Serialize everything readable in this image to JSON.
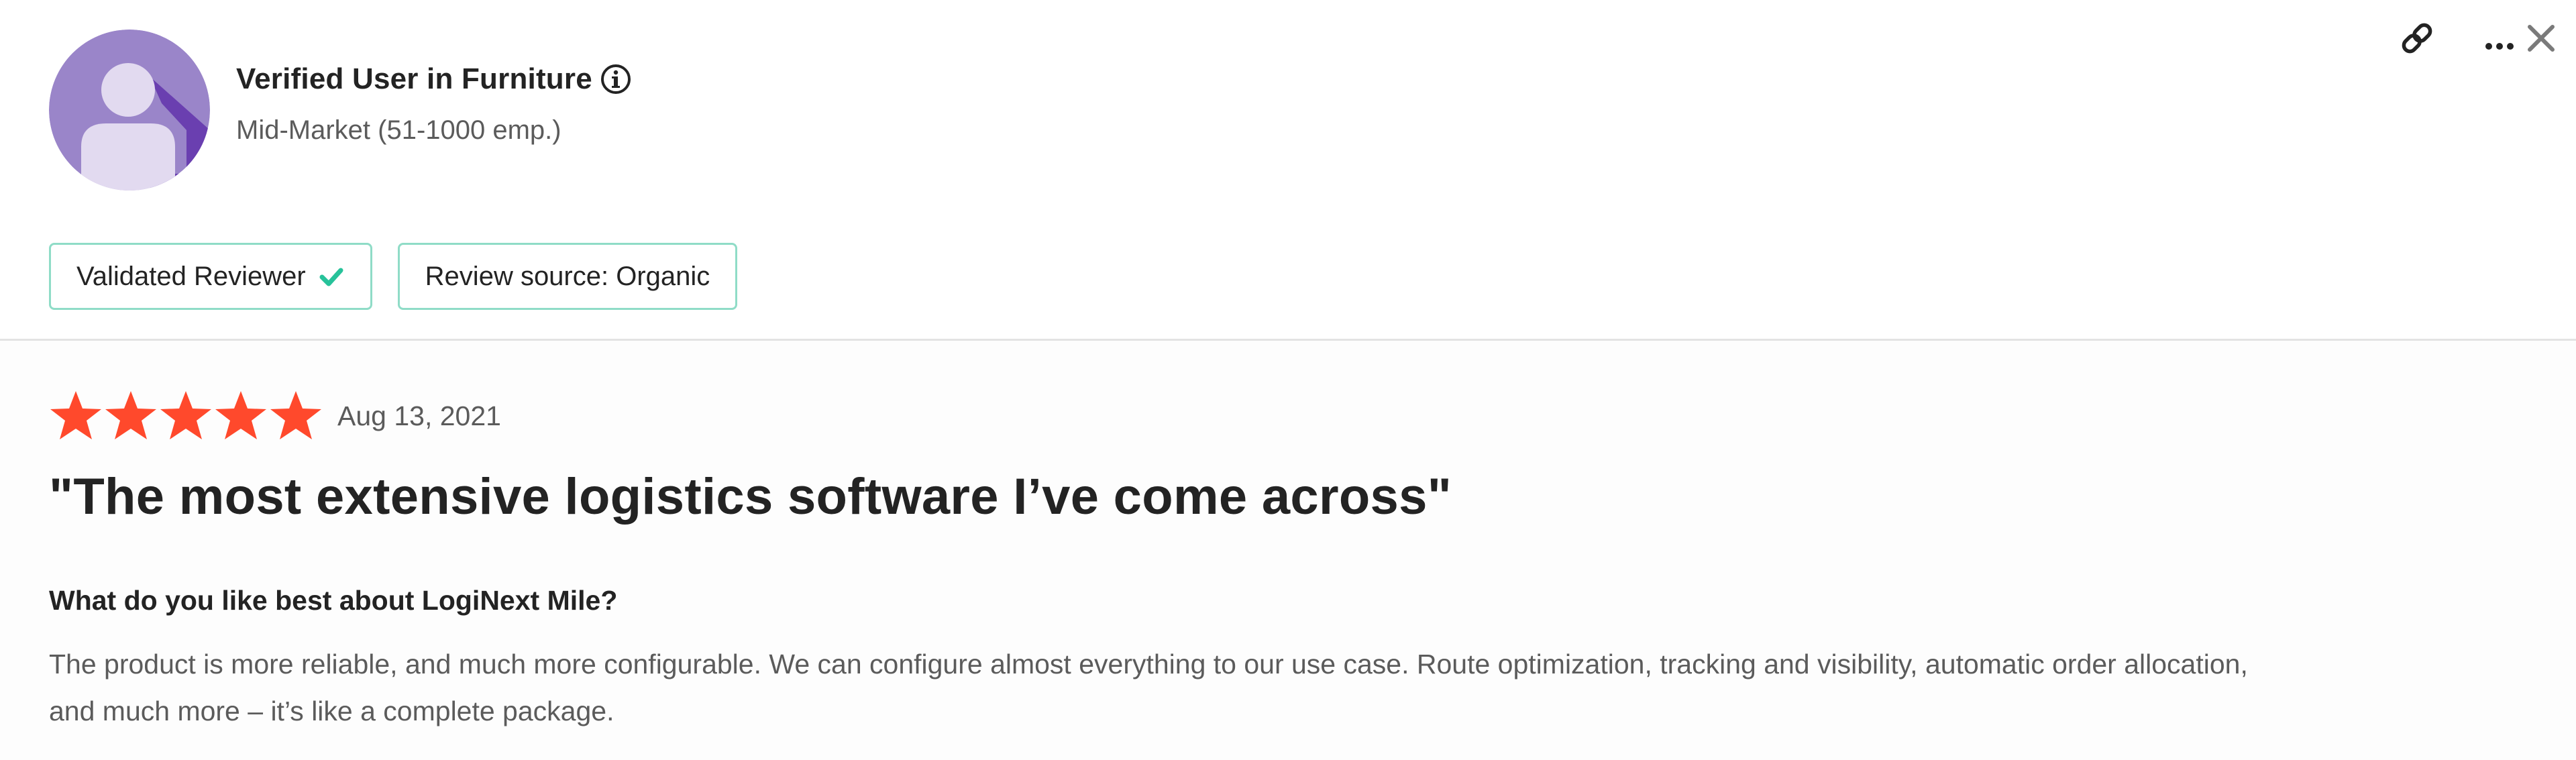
{
  "reviewer": {
    "name": "Verified User in Furniture",
    "segment": "Mid-Market (51-1000 emp.)"
  },
  "badges": [
    {
      "label": "Validated Reviewer"
    },
    {
      "label": "Review source: Organic"
    }
  ],
  "actions": {
    "more_label": "..."
  },
  "review": {
    "rating": 5,
    "rating_max": 5,
    "date": "Aug 13, 2021",
    "title": "\"The most extensive logistics software I’ve come across\"",
    "question": "What do you like best about LogiNext Mile?",
    "answer_lines": [
      "The product is more reliable, and much more configurable. We can configure almost everything to our use case. Route optimization, tracking and visibility, automatic order allocation,",
      "and much more – it’s like a complete package."
    ]
  },
  "colors": {
    "star": "#ff492c",
    "badge_border": "#8fdcc7",
    "check": "#27c29a",
    "avatar_bg": "#9a85c9",
    "avatar_shadow": "#6a3fb0",
    "avatar_figure": "#e2daf0"
  },
  "icons": {
    "info": "info-circle-icon",
    "link": "link-icon",
    "more": "ellipsis-icon",
    "close": "close-icon",
    "check": "check-icon",
    "star": "star-icon",
    "avatar": "user-avatar-icon"
  }
}
